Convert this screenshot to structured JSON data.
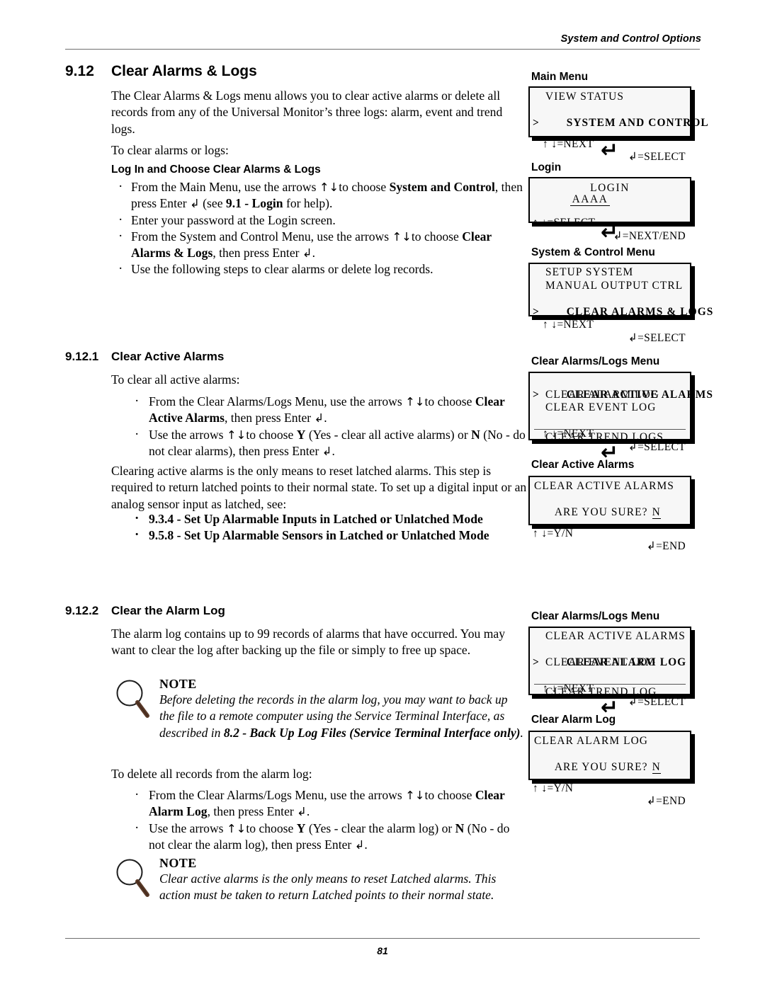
{
  "header": {
    "running_title": "System and Control Options"
  },
  "footer": {
    "page_number": "81"
  },
  "sections": {
    "s912": {
      "number": "9.12",
      "title": "Clear Alarms & Logs",
      "intro": "The Clear Alarms & Logs menu allows you to clear active alarms or delete all records from any of the Universal Monitor’s three logs: alarm, event and trend logs.",
      "lead": "To clear alarms or logs:",
      "subhead": "Log In and Choose Clear Alarms & Logs",
      "bullets": [
        "From the Main Menu, use the arrows ↑↓to choose System and Control, then press Enter ↲ (see 9.1 - Login for help).",
        "Enter your password at the Login screen.",
        "From the System and Control Menu, use the arrows ↑↓to choose Clear Alarms & Logs, then press Enter ↲.",
        "Use the following steps to clear alarms or delete log records."
      ]
    },
    "s9121": {
      "number": "9.12.1",
      "title": "Clear Active Alarms",
      "lead": "To clear all active alarms:",
      "bullets": [
        "From the Clear Alarms/Logs Menu, use the arrows ↑↓to choose Clear Active Alarms, then press Enter ↲.",
        "Use the arrows ↑↓to choose Y (Yes - clear all active alarms) or N (No - do not clear alarms), then press Enter ↲."
      ],
      "paragraph": "Clearing active alarms is the only means to reset latched alarms. This step is required to return latched points to their normal state. To set up a digital input or an analog sensor input as latched, see:",
      "refs": [
        "9.3.4 - Set Up Alarmable Inputs in Latched or Unlatched Mode",
        "9.5.8 - Set Up Alarmable Sensors in Latched or Unlatched Mode"
      ]
    },
    "s9122": {
      "number": "9.12.2",
      "title": "Clear the Alarm Log",
      "paragraph": "The alarm log contains up to 99 records of alarms that have occurred. You may want to clear the log after backing up the file or simply to free up space.",
      "lead": "To delete all records from the alarm log:",
      "bullets": [
        "From the Clear Alarms/Logs Menu, use the arrows ↑↓to choose Clear Alarm Log, then press Enter ↲.",
        "Use the arrows ↑↓to choose Y (Yes - clear the alarm log) or N (No - do not clear the alarm log), then press Enter ↲."
      ]
    }
  },
  "notes": [
    {
      "icon": "magnifier-icon",
      "title": "NOTE",
      "text": "Before deleting the records in the alarm log, you may want to back up the file to a remote computer using the Service Terminal Interface, as described in 8.2 - Back Up Log Files (Service Terminal Interface only)."
    },
    {
      "icon": "magnifier-icon",
      "title": "NOTE",
      "text": "Clear active alarms is the only means to reset Latched alarms. This action must be taken to return Latched points to their normal state."
    }
  ],
  "lcd_panels": {
    "main_menu": {
      "label": "Main Menu",
      "lines": [
        {
          "text": "VIEW STATUS",
          "selected": false,
          "bold": false
        },
        {
          "text": "SYSTEM AND CONTROL",
          "selected": true,
          "bold": true
        }
      ],
      "nav_left": "↑ ↓=NEXT",
      "nav_right": "↲=SELECT"
    },
    "login": {
      "label": "Login",
      "title_line": "LOGIN",
      "value": "AAAA",
      "nav_left": "↑ ↓=SELECT",
      "nav_right": "↲=NEXT/END"
    },
    "system_control_menu": {
      "label": "System & Control Menu",
      "lines": [
        {
          "text": "SETUP SYSTEM",
          "selected": false,
          "bold": false
        },
        {
          "text": "MANUAL OUTPUT CTRL",
          "selected": false,
          "bold": false
        },
        {
          "text": "CLEAR ALARMS & LOGS",
          "selected": true,
          "bold": true
        }
      ],
      "nav_left": "↑ ↓=NEXT",
      "nav_right": "↲=SELECT"
    },
    "clear_menu_1": {
      "label": "Clear Alarms/Logs Menu",
      "lines": [
        {
          "text": "CLEAR ACTIVE ALARMS",
          "selected": true,
          "bold": true
        },
        {
          "text": "CLEAR ALARM LOG",
          "selected": false,
          "bold": false
        },
        {
          "text": "CLEAR EVENT LOG",
          "selected": false,
          "bold": false
        }
      ],
      "nav_left": "↑ ↓=NEXT",
      "nav_right": "↲=SELECT",
      "overflow_line": "CLEAR TREND LOGS"
    },
    "clear_active_alarms": {
      "label": "Clear Active Alarms",
      "line1": "CLEAR ACTIVE ALARMS",
      "line2_prompt": "ARE YOU SURE?",
      "line2_value": "N",
      "nav_left": "↑ ↓=Y/N",
      "nav_right": "↲=END"
    },
    "clear_menu_2": {
      "label": "Clear Alarms/Logs Menu",
      "lines": [
        {
          "text": "CLEAR ACTIVE ALARMS",
          "selected": false,
          "bold": false
        },
        {
          "text": "CLEAR ALARM LOG",
          "selected": true,
          "bold": true
        },
        {
          "text": "CLEAR EVENT LOG",
          "selected": false,
          "bold": false
        }
      ],
      "nav_left": "↑ ↓=NEXT",
      "nav_right": "↲=SELECT",
      "overflow_line": "CLEAR TREND LOG"
    },
    "clear_alarm_log": {
      "label": "Clear Alarm Log",
      "line1": "CLEAR ALARM LOG",
      "line2_prompt": "ARE YOU SURE?",
      "line2_value": "N",
      "nav_left": "↑ ↓=Y/N",
      "nav_right": "↲=END"
    }
  },
  "connectors": {
    "enter_arrow": "↵",
    "selector_marker": ">"
  },
  "colors": {
    "text": "#000000",
    "rule": "#6e6e6e",
    "lcd_bg": "#f7f7f7",
    "lcd_border": "#000000",
    "note_icon_handle": "#5a3a28"
  }
}
